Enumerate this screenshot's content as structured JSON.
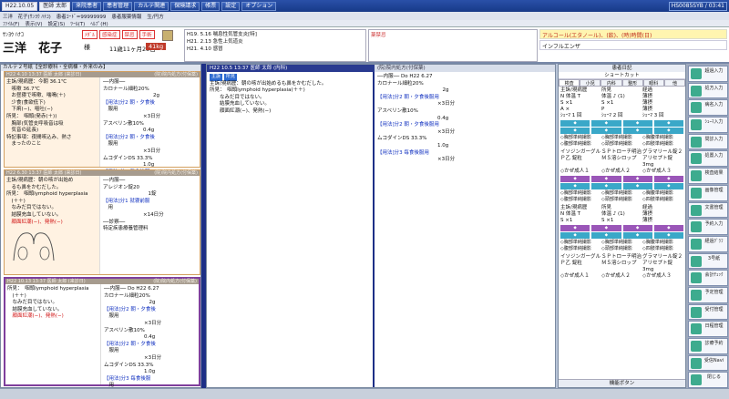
{
  "toolbar": {
    "date": "H22.10.05",
    "doctor": "医師 太郎",
    "dept": "来院患者",
    "patient_mgmt": "患者管理",
    "menu": [
      "カルテ関連",
      "保険請求",
      "帳票",
      "設定",
      "オプション"
    ],
    "host": "HS0085SYB / 03:41"
  },
  "subtoolbar": {
    "text1": "三洋　花子(ｻﾝﾖｳ ﾊﾅｺ)",
    "text2": "患者ｺｰﾄﾞ=99999999",
    "text3": "患者服薬情報",
    "text4": "生/円方"
  },
  "menubar": [
    "ﾌｧｲﾙ(F)",
    "表示(V)",
    "設定(S)",
    "ﾂｰﾙ(T)",
    "ﾍﾙﾌﾟ(H)"
  ],
  "patient": {
    "kana": "ｻﾝﾖｳ ﾊﾅｺ",
    "name": "三洋　花子",
    "honorific": "様",
    "age": "11歳11ヶ月25日",
    "weight": "41kg",
    "badges": [
      "ﾒﾀﾞﾙ",
      "感染症",
      "禁忌",
      "手術"
    ]
  },
  "history": [
    "H19. 5.16 喘息性気管支炎[特]",
    "H21. 2.13 急性上気道炎",
    "H21. 4.10 感冒"
  ],
  "allergy_label": "薬禁忌",
  "comment": {
    "alert": "アルコール(エタノール)、(飲)、(時)時間(日)",
    "influenza": "インフルエンザ"
  },
  "chart": {
    "title": "カルテ２号紙【全診療科・全病棟・外来のみ】"
  },
  "encounters": [
    {
      "hd_l": "H22 4.10 13:37 医師 太郎 (来診日)",
      "hd_r": "(院)院内処方(付保薬)",
      "soap": [
        "主訴/現病歴：今朝 36.1℃",
        "　咳嗽 36.7℃",
        "　お昼寝で咳嗽、喘鳴(＋)",
        "　少食(食欲低下)",
        "　下痢(−)、嘔吐(−)",
        "所見：　咽頭(発赤(＋))",
        "　胸部(気管支呼吸音は吸",
        "　気音の延長)",
        "特記事項：夜間咳込み、熱さ",
        "　まったのこと"
      ],
      "ord": [
        "──内服──",
        "カロナール細粒20%",
        "　　　　　　　　　　2g",
        "【用法]分2 朝・夕食後",
        "　服用",
        "　　　　　　　　×3日分",
        "アスベリン散10%",
        "　　　　　　　　0.4g",
        "【用法]分2 朝・夕食後",
        "　服用",
        "　　　　　　　　×3日分",
        "ムコダインDS 33.3%",
        "　　　　　　　　1.0g",
        "【用法]分3 毎食後服",
        "　用",
        "　　　　　　　　×3日分",
        "──外用──"
      ]
    },
    {
      "hd_l": "H22 6.30 13:37 医師 太郎 (来診日)",
      "hd_r": "(院)院内処方(付保薬)",
      "soap": [
        "主訴/現病歴：朝の咳が出始め",
        "　るも鼻をかむだした。",
        "所見：　咽頭lymphoid hyperplasia",
        "　(＋＋)",
        "　なみだ目ではない。",
        "　結膜充血していない。",
        "　顔面紅潮(−)、発熱(−)"
      ],
      "ord": [
        "──内服──",
        "アレジオン錠20",
        "　　　　　　　　　1錠",
        "【用法]分1 就寝前服",
        "　用",
        "　　　　　　　　×14日分",
        "──診察──",
        "特定疾患療養管理料"
      ]
    },
    {
      "hd_l": "H22 10.13 13:37 医師 太郎 (来診日)",
      "hd_r": "(院)院内処方(付保薬)",
      "soap": [
        "所見：　咽頭lymphoid hyperplasia",
        "　(＋＋)",
        "　なみだ目ではない。",
        "　結膜充血していない。",
        "　顔面紅潮(−)、発熱(−)"
      ],
      "ord": [
        "──内服── Do H22 6.27",
        "カロナール細粒20%",
        "　　　　　　　　　2g",
        "【用法]分2 朝・夕食後",
        "　服用",
        "　　　　　　　　×3日分",
        "アスベリン散10%",
        "　　　　　　　　0.4g",
        "【用法]分2 朝・夕食後",
        "　服用",
        "　　　　　　　　×3日分",
        "ムコダインDS 33.3%",
        "　　　　　　　　1.0g",
        "【用法]分3 毎食後服",
        "　用",
        "　　　　　　　　×3日分",
        "──診察── Do H22 6.30",
        "特定疾患療養管理料"
      ]
    }
  ],
  "main": {
    "hd_l": "H22 10.5 13:37 医師 太郎 (内科)",
    "hd_r": "(院)院内処方(付保薬)",
    "tags": [
      "主訴",
      "所見"
    ],
    "soap": [
      "主訴/現病歴：朝の咳が出始めるも鼻をかむだした。",
      "所見：　咽頭lymphoid hyperplasia(＋＋)",
      "　　なみだ目ではない。",
      "　　結膜充血していない。",
      "　　顔面紅潮(−)、発熱(−)"
    ],
    "ord": [
      "──内服── Do H22 6.27",
      "カロナール細粒20%",
      "　　　　　　　　　　　　　2g",
      "【用法]分2 朝・夕食後服用",
      "　　　　　　　　　　　　×3日分",
      "アスベリン散10%",
      "　　　　　　　　　　　　0.4g",
      "【用法]分2 朝・夕食後服用",
      "　　　　　　　　　　　　×3日分",
      "ムコダインDS 33.3%",
      "　　　　　　　　　　　　1.0g",
      "【用法]分3 毎食後服用",
      "　　　　　　　　　　　　×3日分"
    ]
  },
  "right": {
    "title": "患者日記",
    "sub": "ショートカット",
    "tabs": [
      "検査",
      "小児",
      "内科",
      "整形",
      "眼科",
      "他"
    ],
    "grid1": [
      [
        "主訴/現病歴",
        "所見",
        "経過"
      ],
      [
        "N 体温 T",
        "体温 ♪ (1)",
        "薄摂"
      ],
      [
        "S ×1",
        "S ×1",
        "薄摂"
      ],
      [
        "A ×",
        "P",
        "薄摂"
      ],
      [
        "ｼｪｰﾏ 1 回",
        "ｼｪｰﾏ 2 回",
        "ｼｪｰﾏ 3 回"
      ]
    ],
    "checks": [
      [
        "◇胸部単純撮影",
        "◇胸部単純撮影",
        "◇胸腹単純撮影"
      ],
      [
        "◇腹部単純撮影",
        "◇頭部単純撮影",
        "◇四肢単純撮影"
      ]
    ],
    "drugs": [
      [
        "イソジンガーグル",
        "ＳＰトローチ明治",
        "グラマリール錠２"
      ],
      [
        "Ｐ乙 錠粒",
        "ＭＳ溶シロップ",
        "アリセプト錠 3mg"
      ],
      [
        "◇かぜ成人１",
        "◇かぜ成人２",
        "◇かぜ成人３"
      ]
    ],
    "grid2": [
      [
        "主訴/現病歴",
        "所見",
        "経過"
      ],
      [
        "N 体温 T",
        "体温 ♪ (1)",
        "薄摂"
      ],
      [
        "S ×1",
        "S ×1",
        "薄摂"
      ]
    ],
    "foot": "機能ボタン"
  },
  "side": [
    "超過入力",
    "処方入力",
    "病名入力",
    "ｼｪｰﾏ入力",
    "問診入力",
    "処置入力",
    "検査結果",
    "画像管理",
    "文書管理",
    "予約入力",
    "経過ｸﾞﾗﾌ",
    "3号紙",
    "会計ﾁｪｯｸ",
    "予定管理",
    "受付管理",
    "日程管理",
    "診療予約",
    "受信Navi",
    "閉じる"
  ]
}
